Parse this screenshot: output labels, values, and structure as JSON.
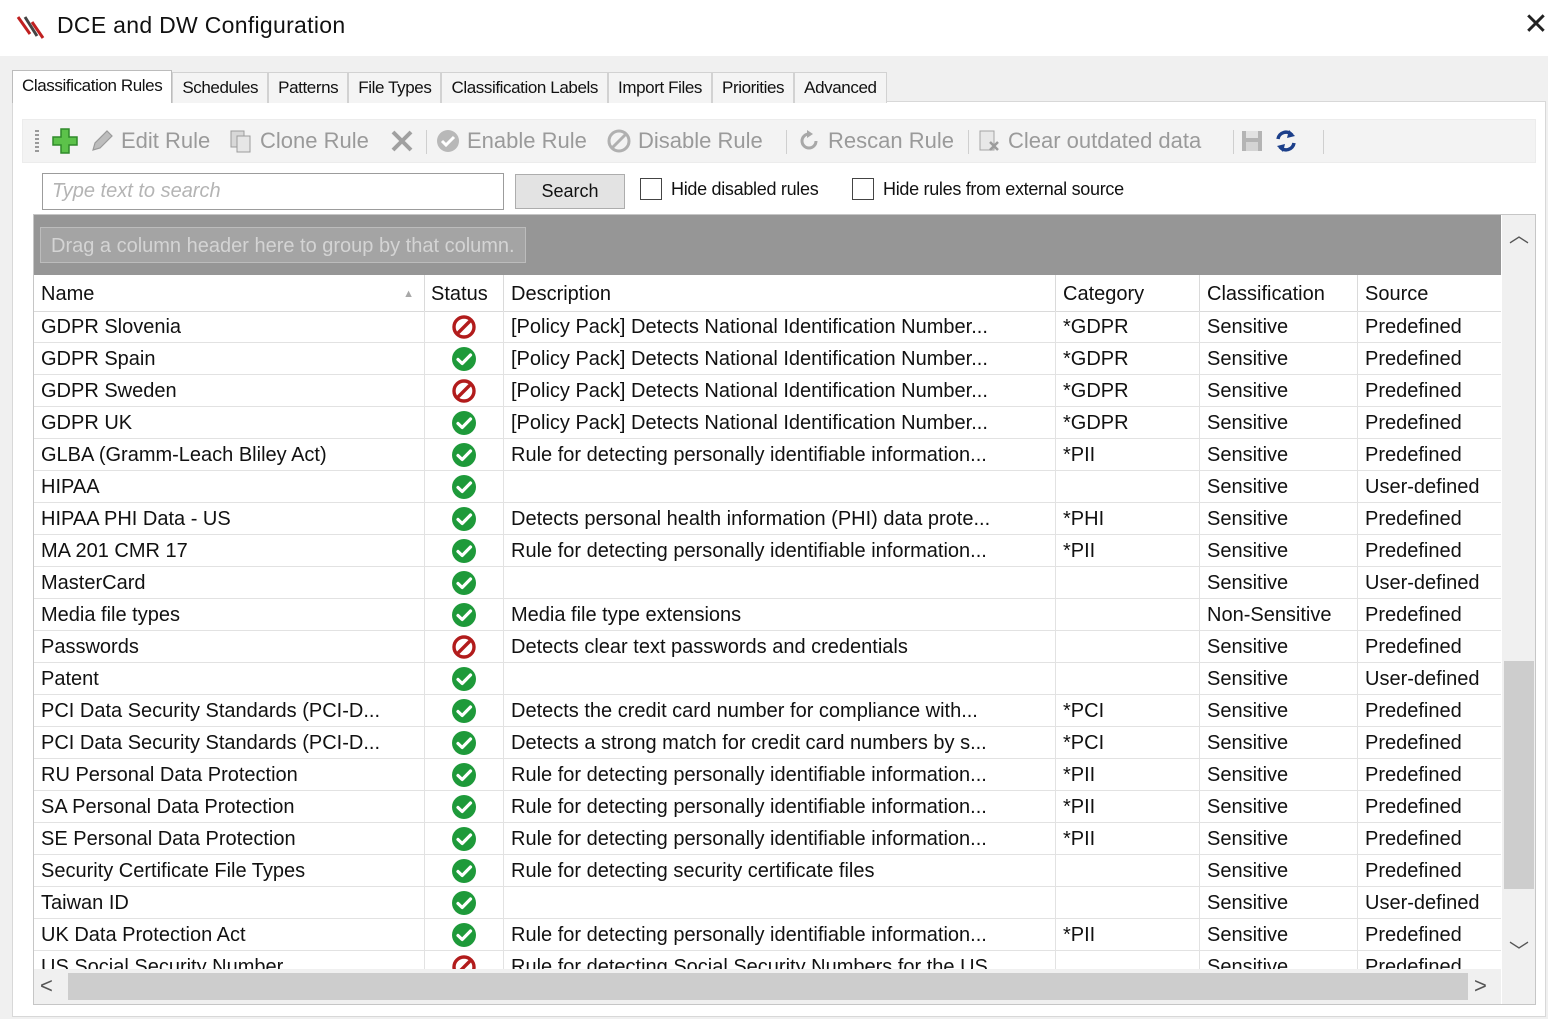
{
  "window": {
    "title": "DCE and DW Configuration"
  },
  "tabs": [
    {
      "label": "Classification Rules",
      "active": true
    },
    {
      "label": "Schedules",
      "active": false
    },
    {
      "label": "Patterns",
      "active": false
    },
    {
      "label": "File Types",
      "active": false
    },
    {
      "label": "Classification Labels",
      "active": false
    },
    {
      "label": "Import Files",
      "active": false
    },
    {
      "label": "Priorities",
      "active": false
    },
    {
      "label": "Advanced",
      "active": false
    }
  ],
  "toolbar": {
    "edit_label": "Edit Rule",
    "clone_label": "Clone Rule",
    "enable_label": "Enable Rule",
    "disable_label": "Disable Rule",
    "rescan_label": "Rescan Rule",
    "clear_label": "Clear outdated data"
  },
  "search": {
    "placeholder": "Type text to search",
    "button_label": "Search",
    "hide_disabled_label": "Hide disabled rules",
    "hide_external_label": "Hide rules from external source"
  },
  "grid": {
    "group_hint": "Drag a column header here to group by that column.",
    "columns": [
      "Name",
      "Status",
      "Description",
      "Category",
      "Classification",
      "Source"
    ],
    "rows": [
      {
        "name": "GDPR Slovenia",
        "status": "disabled",
        "description": "[Policy Pack] Detects National Identification Number...",
        "category": "*GDPR",
        "classification": "Sensitive",
        "source": "Predefined"
      },
      {
        "name": "GDPR Spain",
        "status": "enabled",
        "description": "[Policy Pack] Detects National Identification Number...",
        "category": "*GDPR",
        "classification": "Sensitive",
        "source": "Predefined"
      },
      {
        "name": "GDPR Sweden",
        "status": "disabled",
        "description": "[Policy Pack] Detects National Identification Number...",
        "category": "*GDPR",
        "classification": "Sensitive",
        "source": "Predefined"
      },
      {
        "name": "GDPR UK",
        "status": "enabled",
        "description": "[Policy Pack] Detects National Identification Number...",
        "category": "*GDPR",
        "classification": "Sensitive",
        "source": "Predefined"
      },
      {
        "name": "GLBA (Gramm-Leach Bliley Act)",
        "status": "enabled",
        "description": "Rule for detecting personally identifiable information...",
        "category": "*PII",
        "classification": "Sensitive",
        "source": "Predefined"
      },
      {
        "name": "HIPAA",
        "status": "enabled",
        "description": "",
        "category": "",
        "classification": "Sensitive",
        "source": "User-defined"
      },
      {
        "name": "HIPAA PHI Data - US",
        "status": "enabled",
        "description": "Detects personal health information (PHI) data prote...",
        "category": "*PHI",
        "classification": "Sensitive",
        "source": "Predefined"
      },
      {
        "name": "MA 201 CMR 17",
        "status": "enabled",
        "description": "Rule for detecting personally identifiable information...",
        "category": "*PII",
        "classification": "Sensitive",
        "source": "Predefined"
      },
      {
        "name": "MasterCard",
        "status": "enabled",
        "description": "",
        "category": "",
        "classification": "Sensitive",
        "source": "User-defined"
      },
      {
        "name": "Media file types",
        "status": "enabled",
        "description": "Media file type extensions",
        "category": "",
        "classification": "Non-Sensitive",
        "source": "Predefined"
      },
      {
        "name": "Passwords",
        "status": "disabled",
        "description": "Detects clear text passwords and credentials",
        "category": "",
        "classification": "Sensitive",
        "source": "Predefined"
      },
      {
        "name": "Patent",
        "status": "enabled",
        "description": "",
        "category": "",
        "classification": "Sensitive",
        "source": "User-defined"
      },
      {
        "name": "PCI Data Security Standards (PCI-D...",
        "status": "enabled",
        "description": "Detects the credit card number for compliance with...",
        "category": "*PCI",
        "classification": "Sensitive",
        "source": "Predefined"
      },
      {
        "name": "PCI Data Security Standards (PCI-D...",
        "status": "enabled",
        "description": "Detects a strong match for credit card numbers by s...",
        "category": "*PCI",
        "classification": "Sensitive",
        "source": "Predefined"
      },
      {
        "name": "RU Personal Data Protection",
        "status": "enabled",
        "description": "Rule for detecting personally identifiable information...",
        "category": "*PII",
        "classification": "Sensitive",
        "source": "Predefined"
      },
      {
        "name": "SA Personal Data Protection",
        "status": "enabled",
        "description": "Rule for detecting personally identifiable information...",
        "category": "*PII",
        "classification": "Sensitive",
        "source": "Predefined"
      },
      {
        "name": "SE Personal Data Protection",
        "status": "enabled",
        "description": "Rule for detecting personally identifiable information...",
        "category": "*PII",
        "classification": "Sensitive",
        "source": "Predefined"
      },
      {
        "name": "Security Certificate File Types",
        "status": "enabled",
        "description": "Rule for detecting security certificate files",
        "category": "",
        "classification": "Sensitive",
        "source": "Predefined"
      },
      {
        "name": "Taiwan ID",
        "status": "enabled",
        "description": "",
        "category": "",
        "classification": "Sensitive",
        "source": "User-defined"
      },
      {
        "name": "UK Data Protection Act",
        "status": "enabled",
        "description": "Rule for detecting personally identifiable information...",
        "category": "*PII",
        "classification": "Sensitive",
        "source": "Predefined"
      },
      {
        "name": "US Social Security Number",
        "status": "disabled",
        "description": "Rule for detecting Social Security Numbers for the US",
        "category": "",
        "classification": "Sensitive",
        "source": "Predefined"
      }
    ]
  },
  "colors": {
    "enabled_icon": "#1e9a3a",
    "disabled_icon": "#b21c1c",
    "group_panel": "#969696"
  },
  "icons": {
    "enabled": "check-circle-icon",
    "disabled": "prohibited-icon"
  }
}
